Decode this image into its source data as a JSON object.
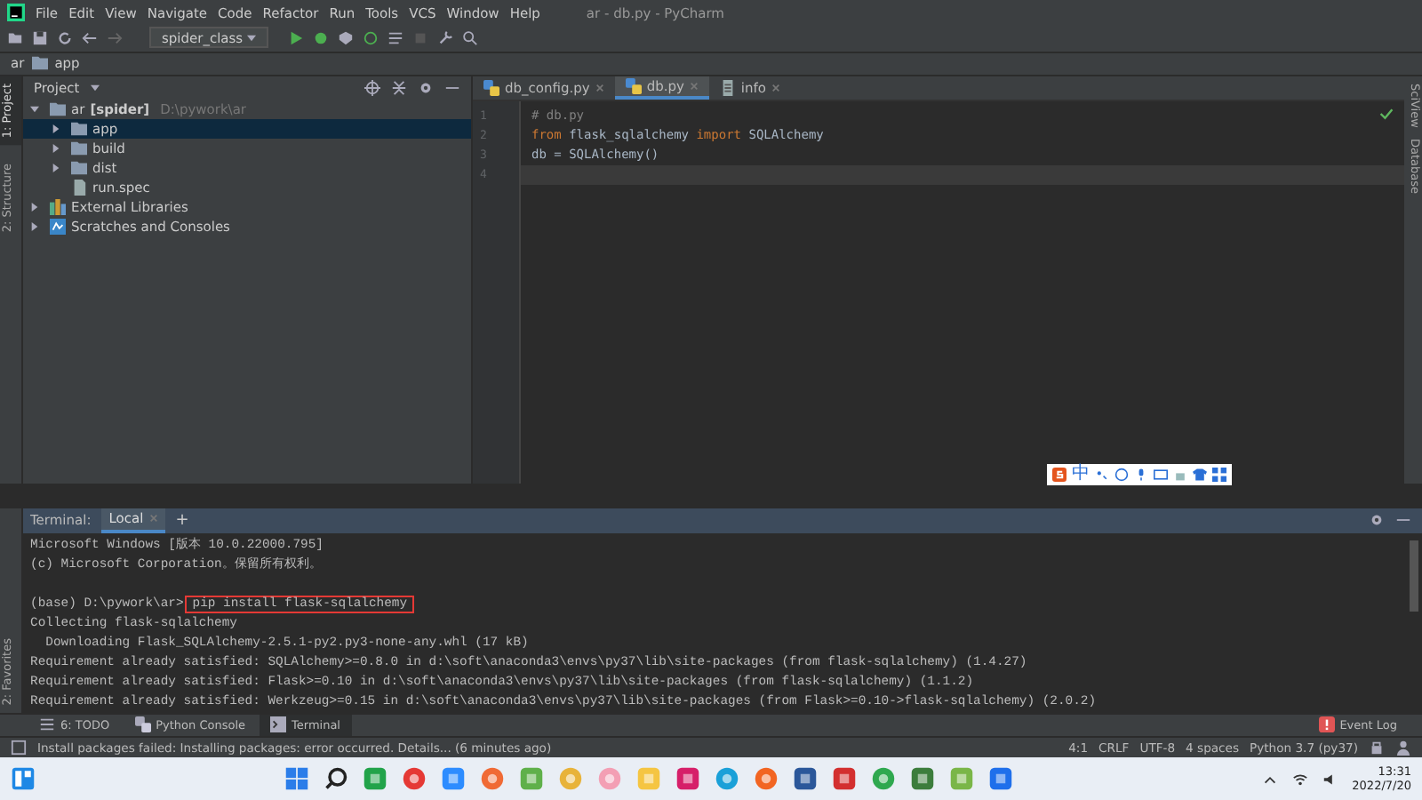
{
  "window": {
    "title": "ar - db.py - PyCharm"
  },
  "menu": [
    "File",
    "Edit",
    "View",
    "Navigate",
    "Code",
    "Refactor",
    "Run",
    "Tools",
    "VCS",
    "Window",
    "Help"
  ],
  "toolbar": {
    "run_config": "spider_class"
  },
  "breadcrumb": [
    "ar",
    "app"
  ],
  "left_strip": [
    {
      "label": "1: Project",
      "selected": true
    },
    {
      "label": "2: Structure",
      "selected": false
    }
  ],
  "left_strip_bottom": [
    {
      "label": "2: Favorites",
      "selected": false
    }
  ],
  "right_strip": [
    "SciView",
    "Database"
  ],
  "project": {
    "title": "Project",
    "tree": [
      {
        "name": "ar",
        "note": "[spider]",
        "path": "D:\\pywork\\ar",
        "kind": "folder",
        "expanded": true,
        "selected": false,
        "children": [
          {
            "name": "app",
            "kind": "folder",
            "expanded": false,
            "selected": true
          },
          {
            "name": "build",
            "kind": "folder",
            "expanded": false,
            "selected": false
          },
          {
            "name": "dist",
            "kind": "folder",
            "expanded": false,
            "selected": false
          },
          {
            "name": "run.spec",
            "kind": "file",
            "selected": false
          }
        ]
      },
      {
        "name": "External Libraries",
        "kind": "library",
        "expanded": false,
        "selected": false
      },
      {
        "name": "Scratches and Consoles",
        "kind": "scratch",
        "expanded": false,
        "selected": false
      }
    ]
  },
  "editor": {
    "tabs": [
      {
        "label": "db_config.py",
        "kind": "python",
        "selected": false
      },
      {
        "label": "db.py",
        "kind": "python",
        "selected": true
      },
      {
        "label": "info",
        "kind": "text",
        "selected": false
      }
    ],
    "lines": [
      {
        "number": "1",
        "current": false,
        "tokens": [
          {
            "t": "# db.py",
            "kind": "comment"
          }
        ]
      },
      {
        "number": "2",
        "current": false,
        "tokens": [
          {
            "t": "from",
            "kind": "keyword"
          },
          {
            "t": " flask_sqlalchemy ",
            "kind": "plain"
          },
          {
            "t": "import",
            "kind": "keyword"
          },
          {
            "t": " SQLAlchemy",
            "kind": "plain"
          }
        ]
      },
      {
        "number": "3",
        "current": false,
        "tokens": [
          {
            "t": "db = SQLAlchemy()",
            "kind": "plain"
          }
        ]
      },
      {
        "number": "4",
        "current": true
      }
    ]
  },
  "ime_bar": {
    "mode": "中"
  },
  "terminal": {
    "label": "Terminal:",
    "tabs": [
      {
        "label": "Local",
        "selected": true
      }
    ],
    "add": "+",
    "lines": [
      {
        "kind": "output",
        "text": "Microsoft Windows [版本 10.0.22000.795]"
      },
      {
        "kind": "output",
        "text": "(c) Microsoft Corporation。保留所有权利。"
      },
      {
        "kind": "command",
        "prompt": "(base) D:\\pywork\\ar>",
        "text": "pip install flask-sqlalchemy",
        "highlighted": true
      },
      {
        "kind": "output",
        "text": "Collecting flask-sqlalchemy"
      },
      {
        "kind": "output",
        "text": "  Downloading Flask_SQLAlchemy-2.5.1-py2.py3-none-any.whl (17 kB)"
      },
      {
        "kind": "output",
        "text": "Requirement already satisfied: SQLAlchemy>=0.8.0 in d:\\soft\\anaconda3\\envs\\py37\\lib\\site-packages (from flask-sqlalchemy) (1.4.27)"
      },
      {
        "kind": "output",
        "text": "Requirement already satisfied: Flask>=0.10 in d:\\soft\\anaconda3\\envs\\py37\\lib\\site-packages (from flask-sqlalchemy) (1.1.2)"
      },
      {
        "kind": "output",
        "text": "Requirement already satisfied: Werkzeug>=0.15 in d:\\soft\\anaconda3\\envs\\py37\\lib\\site-packages (from Flask>=0.10->flask-sqlalchemy) (2.0.2)"
      }
    ]
  },
  "tool_tabs": [
    {
      "label": "6: TODO",
      "kind": "todo",
      "selected": false
    },
    {
      "label": "Python Console",
      "kind": "python",
      "selected": false
    },
    {
      "label": "Terminal",
      "kind": "terminal",
      "selected": true
    }
  ],
  "event_log": "Event Log",
  "status_bar": {
    "message": "Install packages failed: Installing packages: error occurred. Details... (6 minutes ago)",
    "items": [
      "4:1",
      "CRLF",
      "UTF-8",
      "4 spaces",
      "Python 3.7 (py37)"
    ]
  },
  "taskbar": {
    "time": "13:31",
    "date": "2022/7/20"
  }
}
